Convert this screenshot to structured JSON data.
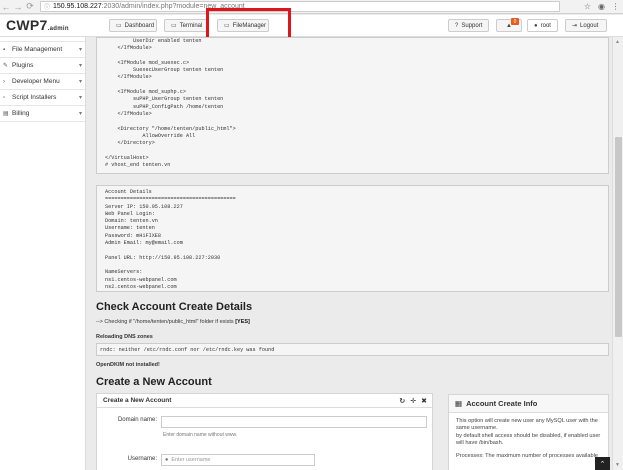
{
  "browser": {
    "url_host": "150.95.108.227",
    "url_path": ":2030/admin/index.php?module=new_account"
  },
  "header": {
    "logo_main": "CWP7",
    "logo_sub": ".admin",
    "buttons": {
      "dashboard": "Dashboard",
      "terminal": "Terminal",
      "filemanager": "FileManager",
      "support": "Support",
      "notifications_count": "0",
      "user": "root",
      "logout": "Logout"
    }
  },
  "sidebar": {
    "items": [
      {
        "label": "File Management"
      },
      {
        "label": "Plugins"
      },
      {
        "label": "Developer Menu"
      },
      {
        "label": "Script Installers"
      },
      {
        "label": "Billing"
      }
    ]
  },
  "vhost_config": "         UserDir enabled tenten\n    </IfModule>\n\n    <IfModule mod_suexec.c>\n         SuexecUserGroup tenten tenten\n    </IfModule>\n\n    <IfModule mod_suphp.c>\n         suPHP_UserGroup tenten tenten\n         suPHP_ConfigPath /home/tenten\n    </IfModule>\n\n    <Directory \"/home/tenten/public_html\">\n            AllowOverride All\n    </Directory>\n\n</VirtualHost>\n# vhost_end tenten.vn",
  "account_details": "Account Details\n==========================================\nServer IP: 150.95.108.227\nWeb Panel Login:\nDomain: tenten.vn\nUsername: tenten\nPassword: mH1FIXE8\nAdmin Email: my@email.com\n\nPanel URL: http://150.95.108.227:2030\n\nNameServers:\nns1.centos-webpanel.com\nns2.centos-webpanel.com",
  "check_section": {
    "title": "Check Account Create Details",
    "checking_prefix": "--> Checking if \"/home/tenten/public_html\" folder if exists",
    "checking_status": "[YES]",
    "reloading": "Reloading DNS zones",
    "rndc_output": "rndc: neither /etc/rndc.conf nor /etc/rndc.key was found",
    "dkim": "OpenDKIM not installed!"
  },
  "create_section": {
    "title": "Create a New Account",
    "panel_title": "Create a New Account",
    "domain_label": "Domain name:",
    "domain_help": "Enter domain name without www.",
    "username_label": "Username:",
    "username_placeholder": "Enter username"
  },
  "info_panel": {
    "title": "Account Create Info",
    "text1": "This option will create new user any MySQL user with the same username.",
    "text2": "by default shell access should be disabled, if enabled user will have /bin/bash.",
    "text3": "Processes: The maximum number of processes available"
  }
}
